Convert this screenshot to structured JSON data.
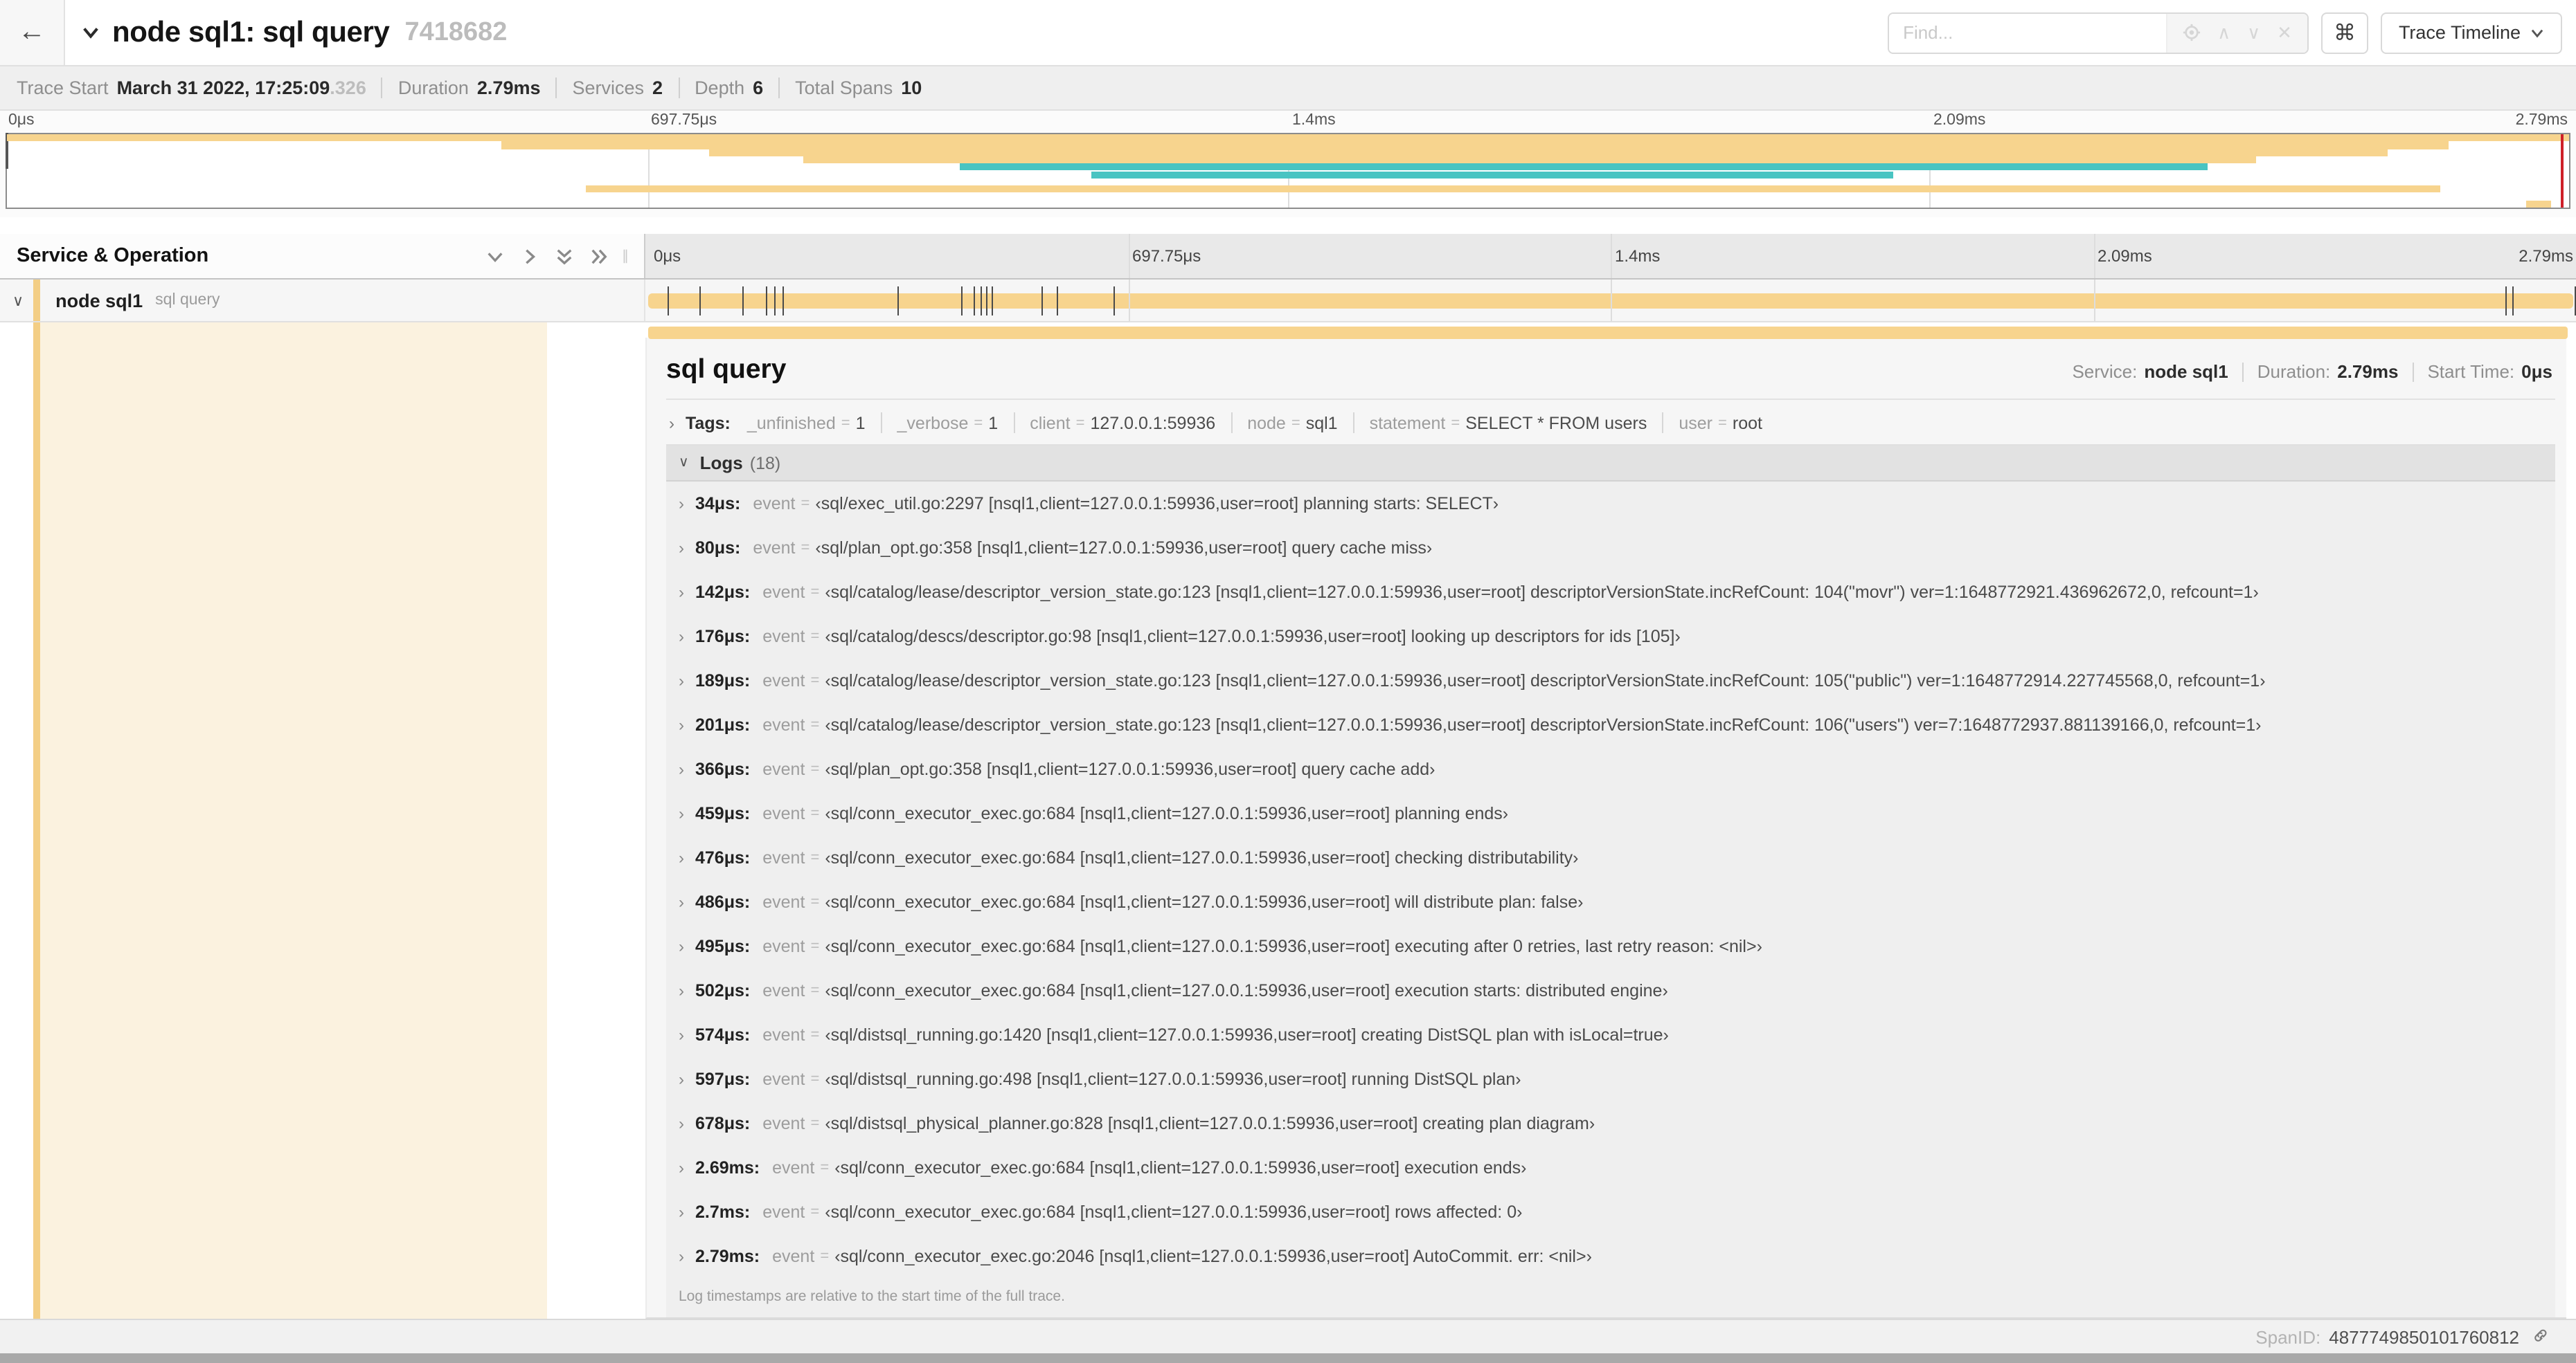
{
  "colors": {
    "amber": "#F7D48E",
    "amber_strip": "#F3CE85",
    "amber_tint": "#FBF2DF",
    "teal": "#49C4C2",
    "cursor_red": "#CE2029"
  },
  "header": {
    "back_label": "←",
    "title": "node sql1: sql query",
    "trace_id": "7418682",
    "find_placeholder": "Find...",
    "shortcuts_button": "⌘",
    "view_dropdown": "Trace Timeline",
    "result_nav": {
      "prev": "∧",
      "next": "∨",
      "clear": "✕"
    }
  },
  "meta": {
    "items": [
      {
        "label": "Trace Start",
        "value": "March 31 2022, 17:25:09",
        "suffix": ".326"
      },
      {
        "label": "Duration",
        "value": "2.79ms",
        "suffix": ""
      },
      {
        "label": "Services",
        "value": "2",
        "suffix": ""
      },
      {
        "label": "Depth",
        "value": "6",
        "suffix": ""
      },
      {
        "label": "Total Spans",
        "value": "10",
        "suffix": ""
      }
    ]
  },
  "timeline": {
    "total_us": 2790,
    "ruler_ticks": [
      {
        "label": "0μs",
        "pct": 0
      },
      {
        "label": "697.75μs",
        "pct": 25
      },
      {
        "label": "1.4ms",
        "pct": 50
      },
      {
        "label": "2.09ms",
        "pct": 75
      },
      {
        "label": "2.79ms",
        "pct": 100
      }
    ],
    "guide_pcts": [
      25,
      50,
      75
    ],
    "section_title": "Service & Operation",
    "row": {
      "service": "node sql1",
      "operation": "sql query"
    },
    "log_tick_us": [
      34,
      80,
      142,
      176,
      189,
      201,
      366,
      459,
      476,
      486,
      495,
      502,
      574,
      597,
      678,
      2690,
      2700,
      2790
    ]
  },
  "minimap": {
    "row_count": 10,
    "bars": [
      {
        "row": 0,
        "start_pct": 0,
        "end_pct": 100,
        "color": "amber"
      },
      {
        "row": 1,
        "start_pct": 19.3,
        "end_pct": 95.3,
        "color": "amber"
      },
      {
        "row": 2,
        "start_pct": 27.4,
        "end_pct": 92.9,
        "color": "amber"
      },
      {
        "row": 3,
        "start_pct": 31.1,
        "end_pct": 87.8,
        "color": "amber"
      },
      {
        "row": 4,
        "start_pct": 37.2,
        "end_pct": 85.9,
        "color": "teal"
      },
      {
        "row": 5,
        "start_pct": 42.3,
        "end_pct": 73.6,
        "color": "teal"
      },
      {
        "row": 7,
        "start_pct": 22.6,
        "end_pct": 95.0,
        "color": "amber"
      },
      {
        "row": 9,
        "start_pct": 98.3,
        "end_pct": 99.3,
        "color": "amber"
      }
    ]
  },
  "detail": {
    "title": "sql query",
    "service_label": "Service:",
    "service": "node sql1",
    "duration_label": "Duration:",
    "duration": "2.79ms",
    "start_label": "Start Time:",
    "start": "0μs",
    "tags_label": "Tags:",
    "tags": [
      {
        "key": "_unfinished",
        "value": "1"
      },
      {
        "key": "_verbose",
        "value": "1"
      },
      {
        "key": "client",
        "value": "127.0.0.1:59936"
      },
      {
        "key": "node",
        "value": "sql1"
      },
      {
        "key": "statement",
        "value": "SELECT * FROM users"
      },
      {
        "key": "user",
        "value": "root"
      }
    ],
    "logs_label": "Logs",
    "logs_count": "(18)",
    "logs": [
      {
        "t": "34μs:",
        "key": "event",
        "value": "‹sql/exec_util.go:2297 [nsql1,client=127.0.0.1:59936,user=root] planning starts: SELECT›"
      },
      {
        "t": "80μs:",
        "key": "event",
        "value": "‹sql/plan_opt.go:358 [nsql1,client=127.0.0.1:59936,user=root] query cache miss›"
      },
      {
        "t": "142μs:",
        "key": "event",
        "value": "‹sql/catalog/lease/descriptor_version_state.go:123 [nsql1,client=127.0.0.1:59936,user=root] descriptorVersionState.incRefCount: 104(\"movr\") ver=1:1648772921.436962672,0, refcount=1›"
      },
      {
        "t": "176μs:",
        "key": "event",
        "value": "‹sql/catalog/descs/descriptor.go:98 [nsql1,client=127.0.0.1:59936,user=root] looking up descriptors for ids [105]›"
      },
      {
        "t": "189μs:",
        "key": "event",
        "value": "‹sql/catalog/lease/descriptor_version_state.go:123 [nsql1,client=127.0.0.1:59936,user=root] descriptorVersionState.incRefCount: 105(\"public\") ver=1:1648772914.227745568,0, refcount=1›"
      },
      {
        "t": "201μs:",
        "key": "event",
        "value": "‹sql/catalog/lease/descriptor_version_state.go:123 [nsql1,client=127.0.0.1:59936,user=root] descriptorVersionState.incRefCount: 106(\"users\") ver=7:1648772937.881139166,0, refcount=1›"
      },
      {
        "t": "366μs:",
        "key": "event",
        "value": "‹sql/plan_opt.go:358 [nsql1,client=127.0.0.1:59936,user=root] query cache add›"
      },
      {
        "t": "459μs:",
        "key": "event",
        "value": "‹sql/conn_executor_exec.go:684 [nsql1,client=127.0.0.1:59936,user=root] planning ends›"
      },
      {
        "t": "476μs:",
        "key": "event",
        "value": "‹sql/conn_executor_exec.go:684 [nsql1,client=127.0.0.1:59936,user=root] checking distributability›"
      },
      {
        "t": "486μs:",
        "key": "event",
        "value": "‹sql/conn_executor_exec.go:684 [nsql1,client=127.0.0.1:59936,user=root] will distribute plan: false›"
      },
      {
        "t": "495μs:",
        "key": "event",
        "value": "‹sql/conn_executor_exec.go:684 [nsql1,client=127.0.0.1:59936,user=root] executing after 0 retries, last retry reason: <nil>›"
      },
      {
        "t": "502μs:",
        "key": "event",
        "value": "‹sql/conn_executor_exec.go:684 [nsql1,client=127.0.0.1:59936,user=root] execution starts: distributed engine›"
      },
      {
        "t": "574μs:",
        "key": "event",
        "value": "‹sql/distsql_running.go:1420 [nsql1,client=127.0.0.1:59936,user=root] creating DistSQL plan with isLocal=true›"
      },
      {
        "t": "597μs:",
        "key": "event",
        "value": "‹sql/distsql_running.go:498 [nsql1,client=127.0.0.1:59936,user=root] running DistSQL plan›"
      },
      {
        "t": "678μs:",
        "key": "event",
        "value": "‹sql/distsql_physical_planner.go:828 [nsql1,client=127.0.0.1:59936,user=root] creating plan diagram›"
      },
      {
        "t": "2.69ms:",
        "key": "event",
        "value": "‹sql/conn_executor_exec.go:684 [nsql1,client=127.0.0.1:59936,user=root] execution ends›"
      },
      {
        "t": "2.7ms:",
        "key": "event",
        "value": "‹sql/conn_executor_exec.go:684 [nsql1,client=127.0.0.1:59936,user=root] rows affected: 0›"
      },
      {
        "t": "2.79ms:",
        "key": "event",
        "value": "‹sql/conn_executor_exec.go:2046 [nsql1,client=127.0.0.1:59936,user=root] AutoCommit. err: <nil>›"
      }
    ],
    "footnote": "Log timestamps are relative to the start time of the full trace.",
    "span_id_label": "SpanID:",
    "span_id": "4877749850101760812"
  }
}
